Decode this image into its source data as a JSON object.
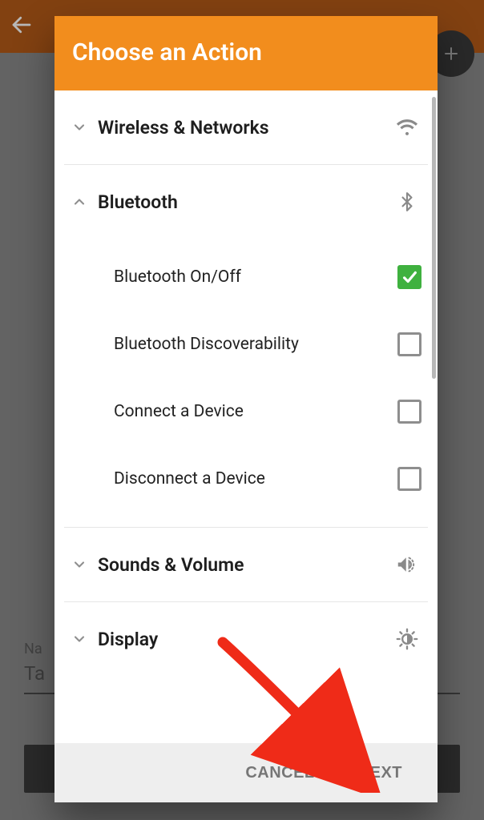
{
  "background": {
    "form_label": "Na",
    "form_value": "Ta"
  },
  "dialog": {
    "title": "Choose an Action",
    "actions": {
      "cancel": "CANCEL",
      "next": "NEXT"
    },
    "categories": [
      {
        "id": "wireless",
        "label": "Wireless & Networks",
        "expanded": false,
        "icon": "wifi",
        "items": []
      },
      {
        "id": "bluetooth",
        "label": "Bluetooth",
        "expanded": true,
        "icon": "bluetooth",
        "items": [
          {
            "label": "Bluetooth On/Off",
            "checked": true
          },
          {
            "label": "Bluetooth Discoverability",
            "checked": false
          },
          {
            "label": "Connect a Device",
            "checked": false
          },
          {
            "label": "Disconnect a Device",
            "checked": false
          }
        ]
      },
      {
        "id": "sounds",
        "label": "Sounds & Volume",
        "expanded": false,
        "icon": "volume",
        "items": []
      },
      {
        "id": "display",
        "label": "Display",
        "expanded": false,
        "icon": "brightness",
        "items": []
      }
    ]
  }
}
